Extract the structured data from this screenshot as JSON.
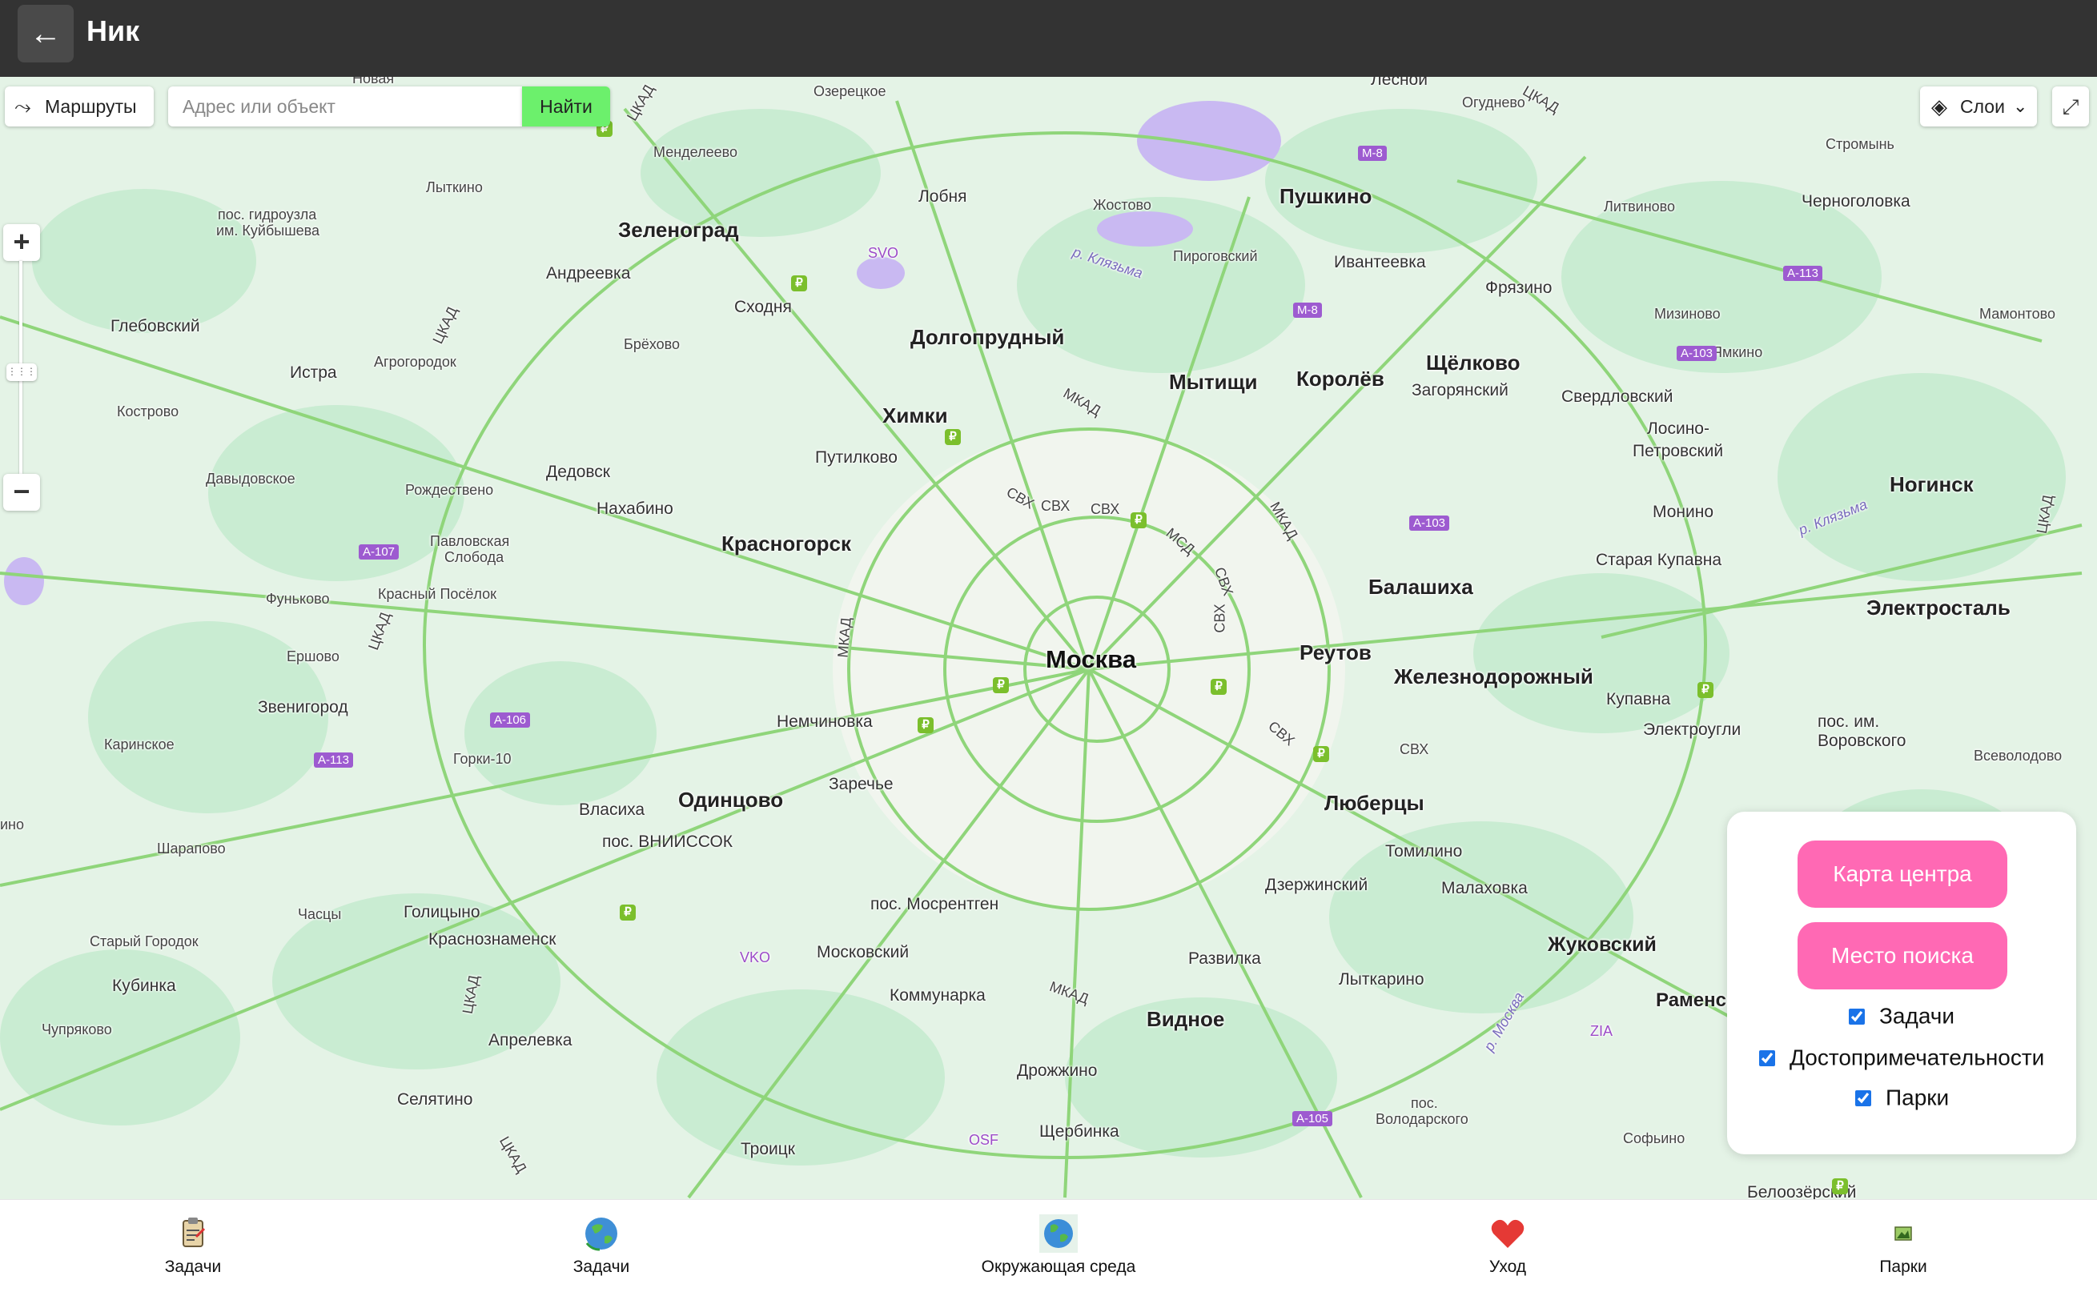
{
  "header": {
    "back_icon": "←",
    "title": "Ник"
  },
  "map_controls": {
    "routes_label": "Маршруты",
    "search_placeholder": "Адрес или объект",
    "search_button": "Найти",
    "layers_label": "Слои",
    "zoom_in": "+",
    "zoom_out": "−"
  },
  "map": {
    "capital": "Москва",
    "big_labels": [
      "Зеленоград",
      "Долгопрудный",
      "Химки",
      "Мытищи",
      "Королёв",
      "Пушкино",
      "Щёлково",
      "Красногорск",
      "Балашиха",
      "Реутов",
      "Железнодорожный",
      "Одинцово",
      "Люберцы",
      "Видное",
      "Ногинск",
      "Электросталь"
    ],
    "labels": [
      "Озерецкое",
      "Менделеево",
      "Лобня",
      "Жостово",
      "Огуднево",
      "Стромынь",
      "Лыткино",
      "пос. гидроузла",
      "им. Куйбышева",
      "Андреевка",
      "Сходня",
      "Пироговский",
      "Ивантеевка",
      "Фрязино",
      "Литвиново",
      "Черноголовка",
      "Мизиново",
      "Мамонтово",
      "Ямкино",
      "Глебовский",
      "Брёхово",
      "Истра",
      "Агрогородок",
      "Загорянский",
      "Свердловский",
      "Лосино-",
      "Петровский",
      "Кострово",
      "Путилково",
      "Давыдовское",
      "Дедовск",
      "Рождествено",
      "Нахабино",
      "Монино",
      "Павловская",
      "Слобода",
      "Старая Купавна",
      "Фуньково",
      "Красный Посёлок",
      "Ершово",
      "Звенигород",
      "Немчиновка",
      "Купавна",
      "Электроугли",
      "пос. им.",
      "Воровского",
      "Всеволодово",
      "Каринское",
      "Горки-10",
      "Заречье",
      "Власиха",
      "пос. ВНИИССОК",
      "Томилино",
      "Шарапово",
      "Дзержинский",
      "Малаховка",
      "Часцы",
      "Голицыно",
      "пос. Мосрентген",
      "Старый Городок",
      "Краснознаменск",
      "Московский",
      "Развилка",
      "Жуковский",
      "Кубинка",
      "Коммунарка",
      "Лыткарино",
      "Раменское",
      "Чупряково",
      "Апрелевка",
      "Дрожжино",
      "Селятино",
      "пос.",
      "Володарского",
      "Щербинка",
      "Софьино",
      "Троицк",
      "Белоозёрский",
      "Лесной",
      "Новая",
      "ино"
    ],
    "roads": [
      "ЦКАД",
      "МКАД",
      "СВХ",
      "МСД",
      "М-8",
      "А-113",
      "А-103",
      "А-107",
      "А-106",
      "А-105"
    ],
    "water": [
      "р. Клязьма",
      "р. Москва"
    ],
    "airports": [
      "SVO",
      "VKO",
      "ZIA",
      "OSF"
    ],
    "fuel_symbol": "₽"
  },
  "panel": {
    "btn_center": "Карта центра",
    "btn_search_place": "Место поиска",
    "checkboxes": [
      {
        "label": "Задачи",
        "checked": true
      },
      {
        "label": "Достопримечательности",
        "checked": true
      },
      {
        "label": "Парки",
        "checked": true
      }
    ]
  },
  "bottom_nav": [
    {
      "label": "Задачи",
      "icon": "clipboard-icon"
    },
    {
      "label": "Задачи",
      "icon": "globe-recycle-icon"
    },
    {
      "label": "Окружающая среда",
      "icon": "earth-icon"
    },
    {
      "label": "Уход",
      "icon": "heart-icon"
    },
    {
      "label": "Парки",
      "icon": "park-picture-icon"
    }
  ],
  "colors": {
    "topbar": "#333333",
    "search_button": "#6cf06c",
    "pink": "#ff69b4",
    "road": "#7fd46c",
    "forest": "#c9ecd2",
    "water": "#c9b9f2",
    "route_shield": "#9d5bd0"
  }
}
